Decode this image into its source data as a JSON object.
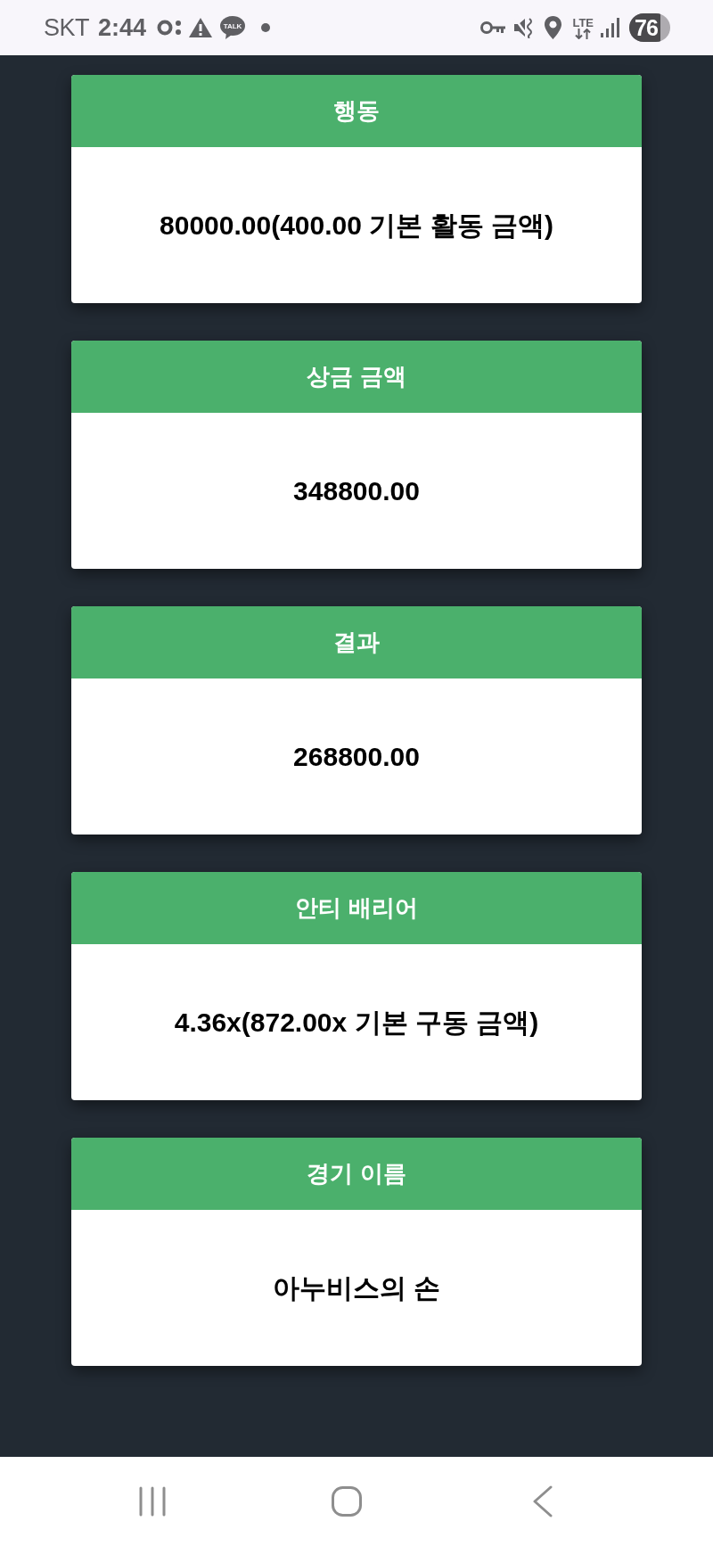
{
  "status_bar": {
    "carrier": "SKT",
    "time": "2:44",
    "talk_badge": "TALK",
    "network": "LTE",
    "battery": "76"
  },
  "cards": [
    {
      "title": "행동",
      "value": "80000.00(400.00 기본 활동 금액)"
    },
    {
      "title": "상금 금액",
      "value": "348800.00"
    },
    {
      "title": "결과",
      "value": "268800.00"
    },
    {
      "title": "안티 배리어",
      "value": "4.36x(872.00x 기본 구동 금액)"
    },
    {
      "title": "경기 이름",
      "value": "아누비스의 손"
    }
  ]
}
